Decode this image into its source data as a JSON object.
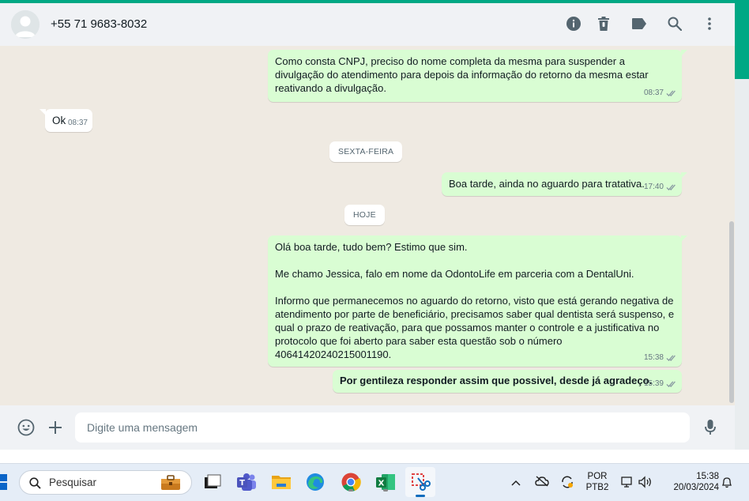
{
  "header": {
    "contact": "+55 71 9683-8032",
    "icons": [
      "info-icon",
      "trash-icon",
      "label-icon",
      "search-icon",
      "menu-dots-icon"
    ]
  },
  "messages": [
    {
      "dir": "out",
      "paras": [
        "Como consta CNPJ, preciso do nome completa da mesma para suspender a divulgação do atendimento para depois da informação do retorno da mesma estar reativando a divulgação."
      ],
      "time": "08:37",
      "read": true
    },
    {
      "dir": "in",
      "paras": [
        "Ok"
      ],
      "time": "08:37"
    },
    {
      "dir": "out",
      "paras": [
        "Boa tarde, ainda no aguardo para tratativa."
      ],
      "time": "17:40",
      "read": true
    },
    {
      "dir": "out",
      "paras": [
        "Olá boa tarde, tudo bem? Estimo que sim.",
        "Me chamo Jessica, falo em nome da OdontoLife em parceria com a DentalUni.",
        "Informo que permanecemos no aguardo do retorno, visto que está gerando negativa de atendimento por parte de beneficiário, precisamos saber qual dentista será suspenso, e qual o prazo de reativação, para que possamos manter o controle e a justificativa no protocolo que foi aberto para saber esta questão sob o número 40641420240215001190."
      ],
      "time": "15:38",
      "read": true
    },
    {
      "dir": "out",
      "paras": [
        "Por gentileza responder assim que possivel,  desde já agradeço."
      ],
      "bold": true,
      "time": "15:39",
      "read": true
    }
  ],
  "day_separators": [
    "SEXTA-FEIRA",
    "HOJE"
  ],
  "composer": {
    "placeholder": "Digite uma mensagem",
    "icons": [
      "emoji-icon",
      "plus-icon",
      "mic-icon"
    ]
  },
  "taskbar": {
    "search_placeholder": "Pesquisar",
    "apps": [
      "windows-start-icon",
      "search-icon",
      "file-explorer-icon",
      "task-view-icon",
      "teams-icon",
      "folder-icon",
      "edge-icon",
      "chrome-icon",
      "excel-icon",
      "snipping-tool-icon"
    ],
    "tray": {
      "lang_top": "POR",
      "lang_bottom": "PTB2",
      "time": "15:38",
      "date": "20/03/2024"
    }
  }
}
